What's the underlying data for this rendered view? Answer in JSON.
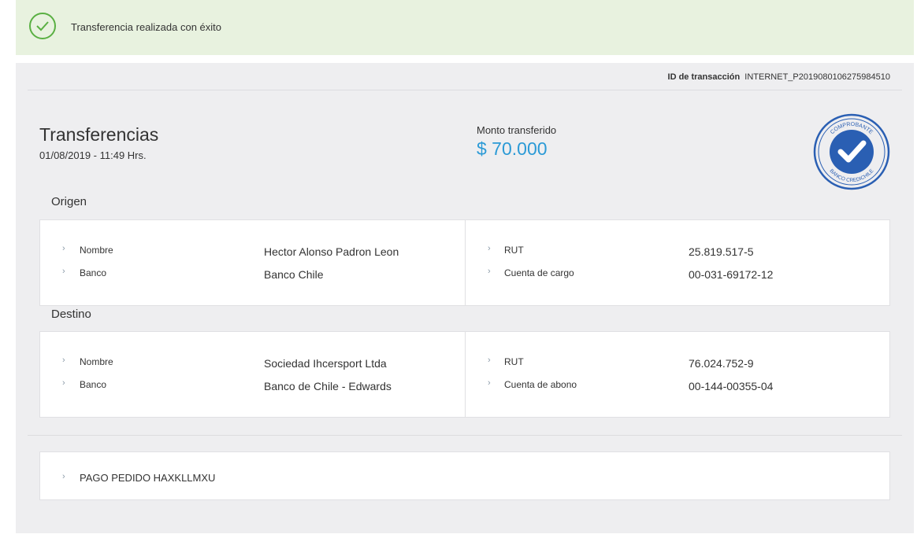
{
  "banner": {
    "message": "Transferencia realizada con éxito",
    "status_color": "#5ab043"
  },
  "transaction": {
    "id_label": "ID de transacción",
    "id_value": "INTERNET_P2019080106275984510"
  },
  "summary": {
    "title": "Transferencias",
    "date": "01/08/2019 - 11:49 Hrs.",
    "amount_label": "Monto transferido",
    "amount": "$ 70.000",
    "accent_color": "#2b9ad6"
  },
  "seal": {
    "top_text": "COMPROBANTE",
    "bottom_text": "BANCO CREDICHILE",
    "color": "#2a5fb3"
  },
  "origen": {
    "label": "Origen",
    "left": [
      {
        "label": "Nombre",
        "value": "Hector Alonso Padron Leon"
      },
      {
        "label": "Banco",
        "value": "Banco Chile"
      }
    ],
    "right": [
      {
        "label": "RUT",
        "value": "25.819.517-5"
      },
      {
        "label": "Cuenta de cargo",
        "value": "00-031-69172-12"
      }
    ]
  },
  "destino": {
    "label": "Destino",
    "left": [
      {
        "label": "Nombre",
        "value": "Sociedad Ihcersport Ltda"
      },
      {
        "label": "Banco",
        "value": "Banco de Chile - Edwards"
      }
    ],
    "right": [
      {
        "label": "RUT",
        "value": "76.024.752-9"
      },
      {
        "label": "Cuenta de abono",
        "value": "00-144-00355-04"
      }
    ]
  },
  "note": {
    "text": "PAGO PEDIDO HAXKLLMXU"
  }
}
